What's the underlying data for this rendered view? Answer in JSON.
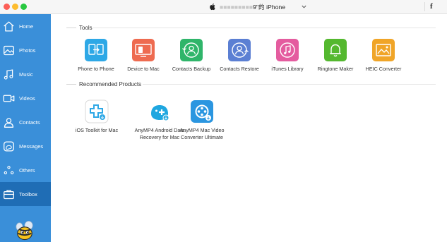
{
  "window": {
    "device_prefix": "■■■■■■■■■",
    "device_suffix": "9\"的 iPhone",
    "facebook_glyph": "f"
  },
  "sidebar": {
    "items": [
      {
        "label": "Home",
        "icon": "home-icon"
      },
      {
        "label": "Photos",
        "icon": "photos-icon"
      },
      {
        "label": "Music",
        "icon": "music-icon"
      },
      {
        "label": "Videos",
        "icon": "videos-icon"
      },
      {
        "label": "Contacts",
        "icon": "contacts-icon"
      },
      {
        "label": "Messages",
        "icon": "messages-icon"
      },
      {
        "label": "Others",
        "icon": "others-icon"
      },
      {
        "label": "Toolbox",
        "icon": "toolbox-icon"
      }
    ],
    "active": "Toolbox"
  },
  "tools": {
    "heading": "Tools",
    "items": [
      {
        "label": "Phone to Phone",
        "icon": "phone-transfer-icon",
        "color": "#2ea8e6"
      },
      {
        "label": "Device to Mac",
        "icon": "device-to-mac-icon",
        "color": "#ee6b50"
      },
      {
        "label": "Contacts Backup",
        "icon": "contacts-backup-icon",
        "color": "#2fb56a"
      },
      {
        "label": "Contacts Restore",
        "icon": "contacts-restore-icon",
        "color": "#5b7fd3"
      },
      {
        "label": "iTunes Library",
        "icon": "itunes-library-icon",
        "color": "#e45c9f"
      },
      {
        "label": "Ringtone Maker",
        "icon": "ringtone-bell-icon",
        "color": "#54b82f"
      },
      {
        "label": "HEIC Converter",
        "icon": "heic-image-icon",
        "color": "#f0a528"
      }
    ]
  },
  "products": {
    "heading": "Recommended Products",
    "items": [
      {
        "label": "iOS Toolkit for Mac",
        "icon": "ios-toolkit-icon"
      },
      {
        "label": "AnyMP4 Android Data Recovery for Mac",
        "icon": "android-recovery-icon"
      },
      {
        "label": "AnyMP4 Mac Video Converter Ultimate",
        "icon": "video-converter-icon"
      }
    ]
  }
}
